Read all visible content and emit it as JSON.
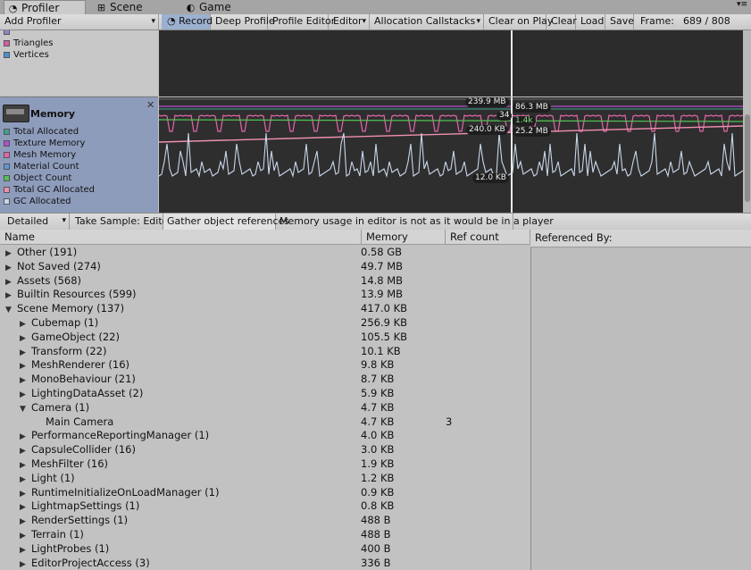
{
  "tabs": [
    {
      "label": "Profiler",
      "icon": "profiler-icon",
      "active": true
    },
    {
      "label": "Scene",
      "icon": "grid-icon",
      "active": false
    },
    {
      "label": "Game",
      "icon": "pacman-icon",
      "active": false
    }
  ],
  "toolbar": {
    "add_profiler": "Add Profiler",
    "record": "Record",
    "deep_profile": "Deep Profile",
    "profile_editor": "Profile Editor",
    "editor": "Editor",
    "allocation_callstacks": "Allocation Callstacks",
    "clear_on_play": "Clear on Play",
    "clear": "Clear",
    "load": "Load",
    "save": "Save",
    "frame_label": "Frame:",
    "frame_value": "689 / 808"
  },
  "top_legend": [
    {
      "label": "Triangles",
      "color": "#d45fa6"
    },
    {
      "label": "Vertices",
      "color": "#4d8fd6"
    }
  ],
  "memory": {
    "title": "Memory",
    "legend": [
      {
        "label": "Total Allocated",
        "color": "#3fa38f"
      },
      {
        "label": "Texture Memory",
        "color": "#b04fd0"
      },
      {
        "label": "Mesh Memory",
        "color": "#e267a8"
      },
      {
        "label": "Material Count",
        "color": "#5b98d8"
      },
      {
        "label": "Object Count",
        "color": "#53c153"
      },
      {
        "label": "Total GC Allocated",
        "color": "#f08fb0"
      },
      {
        "label": "GC Allocated",
        "color": "#c8d7ea"
      }
    ],
    "value_labels": [
      "239.9 MB",
      "86.3 MB",
      "34",
      "1.4k",
      "240.0 KB",
      "25.2 MB",
      "12.0 KB"
    ]
  },
  "detail_toolbar": {
    "mode": "Detailed",
    "take_sample": "Take Sample: Editor",
    "gather": "Gather object references",
    "notice": "Memory usage in editor is not as it would be in a player"
  },
  "table": {
    "headers": {
      "name": "Name",
      "memory": "Memory",
      "ref": "Ref count",
      "referenced_by": "Referenced By:"
    },
    "rows": [
      {
        "name": "Other (191)",
        "memory": "0.58 GB",
        "ref": "",
        "indent": 0,
        "expand": "collapsed"
      },
      {
        "name": "Not Saved (274)",
        "memory": "49.7 MB",
        "ref": "",
        "indent": 0,
        "expand": "collapsed"
      },
      {
        "name": "Assets (568)",
        "memory": "14.8 MB",
        "ref": "",
        "indent": 0,
        "expand": "collapsed"
      },
      {
        "name": "Builtin Resources (599)",
        "memory": "13.9 MB",
        "ref": "",
        "indent": 0,
        "expand": "collapsed"
      },
      {
        "name": "Scene Memory (137)",
        "memory": "417.0 KB",
        "ref": "",
        "indent": 0,
        "expand": "expanded"
      },
      {
        "name": "Cubemap (1)",
        "memory": "256.9 KB",
        "ref": "",
        "indent": 1,
        "expand": "collapsed"
      },
      {
        "name": "GameObject (22)",
        "memory": "105.5 KB",
        "ref": "",
        "indent": 1,
        "expand": "collapsed"
      },
      {
        "name": "Transform (22)",
        "memory": "10.1 KB",
        "ref": "",
        "indent": 1,
        "expand": "collapsed"
      },
      {
        "name": "MeshRenderer (16)",
        "memory": "9.8 KB",
        "ref": "",
        "indent": 1,
        "expand": "collapsed"
      },
      {
        "name": "MonoBehaviour (21)",
        "memory": "8.7 KB",
        "ref": "",
        "indent": 1,
        "expand": "collapsed"
      },
      {
        "name": "LightingDataAsset (2)",
        "memory": "5.9 KB",
        "ref": "",
        "indent": 1,
        "expand": "collapsed"
      },
      {
        "name": "Camera (1)",
        "memory": "4.7 KB",
        "ref": "",
        "indent": 1,
        "expand": "expanded"
      },
      {
        "name": "Main Camera",
        "memory": "4.7 KB",
        "ref": "3",
        "indent": 2,
        "expand": "none"
      },
      {
        "name": "PerformanceReportingManager (1)",
        "memory": "4.0 KB",
        "ref": "",
        "indent": 1,
        "expand": "collapsed"
      },
      {
        "name": "CapsuleCollider (16)",
        "memory": "3.0 KB",
        "ref": "",
        "indent": 1,
        "expand": "collapsed"
      },
      {
        "name": "MeshFilter (16)",
        "memory": "1.9 KB",
        "ref": "",
        "indent": 1,
        "expand": "collapsed"
      },
      {
        "name": "Light (1)",
        "memory": "1.2 KB",
        "ref": "",
        "indent": 1,
        "expand": "collapsed"
      },
      {
        "name": "RuntimeInitializeOnLoadManager (1)",
        "memory": "0.9 KB",
        "ref": "",
        "indent": 1,
        "expand": "collapsed"
      },
      {
        "name": "LightmapSettings (1)",
        "memory": "0.8 KB",
        "ref": "",
        "indent": 1,
        "expand": "collapsed"
      },
      {
        "name": "RenderSettings (1)",
        "memory": "488 B",
        "ref": "",
        "indent": 1,
        "expand": "collapsed"
      },
      {
        "name": "Terrain (1)",
        "memory": "488 B",
        "ref": "",
        "indent": 1,
        "expand": "collapsed"
      },
      {
        "name": "LightProbes (1)",
        "memory": "400 B",
        "ref": "",
        "indent": 1,
        "expand": "collapsed"
      },
      {
        "name": "EditorProjectAccess (3)",
        "memory": "336 B",
        "ref": "",
        "indent": 1,
        "expand": "collapsed"
      }
    ]
  }
}
